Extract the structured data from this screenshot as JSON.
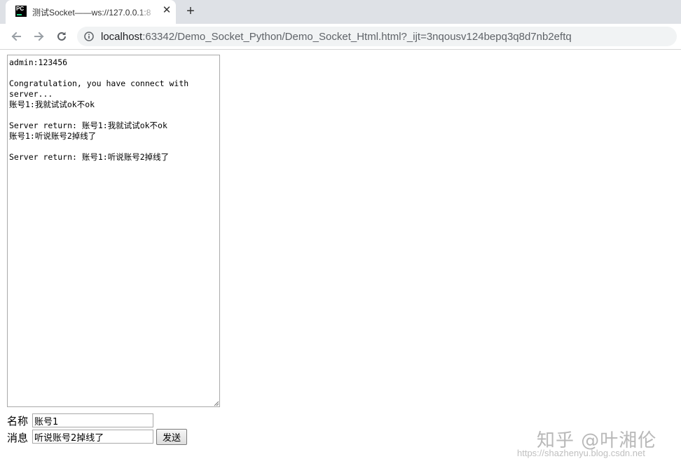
{
  "browser": {
    "tab": {
      "favicon_text": "PC",
      "title": "测试Socket——ws://127.0.0.1:8",
      "close_icon": "close-icon"
    },
    "new_tab_icon": "plus-icon",
    "nav": {
      "back_icon": "arrow-back-icon",
      "forward_icon": "arrow-forward-icon",
      "reload_icon": "reload-icon"
    },
    "address": {
      "host": "localhost",
      "rest": ":63342/Demo_Socket_Python/Demo_Socket_Html.html?_ijt=3nqousv124bepq3q8d7nb2eftq"
    }
  },
  "page": {
    "log_text": "admin:123456\n\nCongratulation, you have connect with server...\n账号1:我就试试ok不ok\n\nServer return: 账号1:我就试试ok不ok\n账号1:听说账号2掉线了\n\nServer return: 账号1:听说账号2掉线了",
    "name_label": "名称",
    "name_value": "账号1",
    "message_label": "消息",
    "message_value": "听说账号2掉线了",
    "send_label": "发送"
  },
  "watermark": {
    "main": "知乎 @叶湘伦",
    "url": "https://shazhenyu.blog.csdn.net"
  }
}
